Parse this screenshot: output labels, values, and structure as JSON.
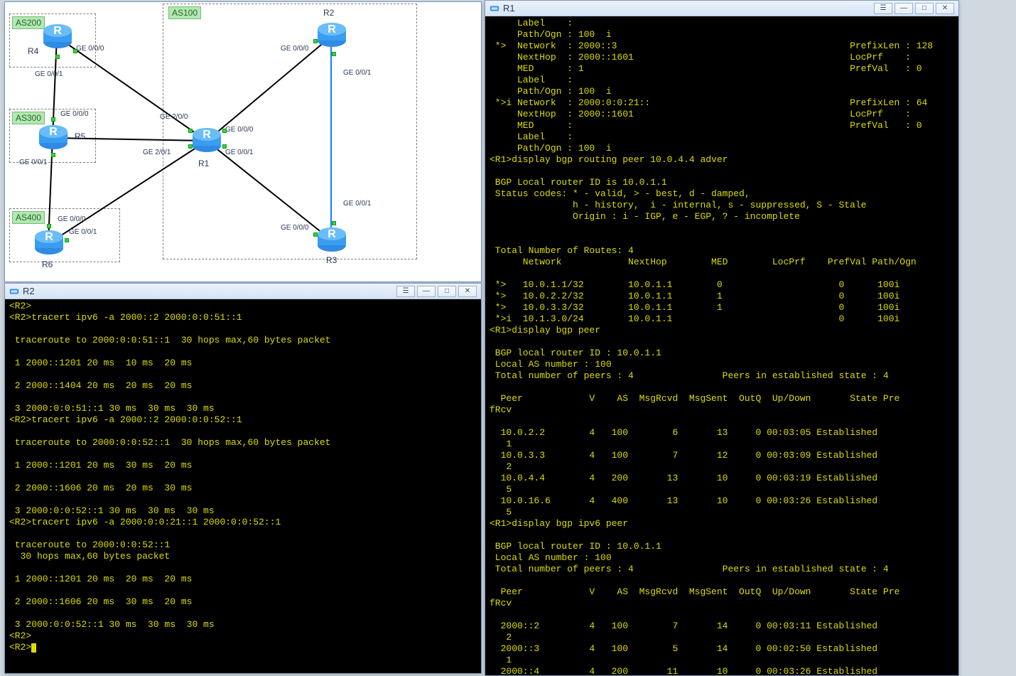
{
  "windows": {
    "r1": {
      "title": "R1"
    },
    "r2": {
      "title": "R2"
    },
    "topology": {
      "title": ""
    }
  },
  "winbtns": {
    "min": "—",
    "max": "□",
    "close": "✕"
  },
  "topology": {
    "as_labels": {
      "as200": "AS200",
      "as300": "AS300",
      "as400": "AS400",
      "as100": "AS100"
    },
    "routers": {
      "r1": "R1",
      "r2": "R2",
      "r3": "R3",
      "r4": "R4",
      "r5": "R5",
      "r6": "R6"
    },
    "interfaces": {
      "ge000": "GE 0/0/0",
      "ge001": "GE 0/0/1",
      "ge200": "GE 2/0/0",
      "ge201": "GE 2/0/1"
    }
  },
  "r2_output": "<R2>\n<R2>tracert ipv6 -a 2000::2 2000:0:0:51::1\n\n traceroute to 2000:0:0:51::1  30 hops max,60 bytes packet\n\n 1 2000::1201 20 ms  10 ms  20 ms\n\n 2 2000::1404 20 ms  20 ms  20 ms\n\n 3 2000:0:0:51::1 30 ms  30 ms  30 ms\n<R2>tracert ipv6 -a 2000::2 2000:0:0:52::1\n\n traceroute to 2000:0:0:52::1  30 hops max,60 bytes packet\n\n 1 2000::1201 20 ms  30 ms  20 ms\n\n 2 2000::1606 20 ms  20 ms  30 ms\n\n 3 2000:0:0:52::1 30 ms  30 ms  30 ms\n<R2>tracert ipv6 -a 2000:0:0:21::1 2000:0:0:52::1\n\n traceroute to 2000:0:0:52::1\n  30 hops max,60 bytes packet\n\n 1 2000::1201 20 ms  20 ms  20 ms\n\n 2 2000::1606 20 ms  30 ms  20 ms\n\n 3 2000:0:0:52::1 30 ms  30 ms  30 ms\n<R2>\n<R2>",
  "r1_output": "     Label    :\n     Path/Ogn : 100  i\n *>  Network  : 2000::3                                          PrefixLen : 128\n     NextHop  : 2000::1601                                       LocPrf    :\n     MED      : 1                                                PrefVal   : 0\n     Label    :\n     Path/Ogn : 100  i\n *>i Network  : 2000:0:0:21::                                    PrefixLen : 64\n     NextHop  : 2000::1601                                       LocPrf    :\n     MED      :                                                  PrefVal   : 0\n     Label    :\n     Path/Ogn : 100  i\n<R1>display bgp routing peer 10.0.4.4 adver\n\n BGP Local router ID is 10.0.1.1\n Status codes: * - valid, > - best, d - damped,\n               h - history,  i - internal, s - suppressed, S - Stale\n               Origin : i - IGP, e - EGP, ? - incomplete\n\n\n Total Number of Routes: 4\n      Network            NextHop        MED        LocPrf    PrefVal Path/Ogn\n\n *>   10.0.1.1/32        10.0.1.1        0                     0      100i\n *>   10.0.2.2/32        10.0.1.1        1                     0      100i\n *>   10.0.3.3/32        10.0.1.1        1                     0      100i\n *>i  10.1.3.0/24        10.0.1.1                              0      100i\n<R1>display bgp peer\n\n BGP local router ID : 10.0.1.1\n Local AS number : 100\n Total number of peers : 4\t\t  Peers in established state : 4\n\n  Peer            V    AS  MsgRcvd  MsgSent  OutQ  Up/Down       State Pre\nfRcv\n\n  10.0.2.2        4   100        6       13     0 00:03:05 Established\n   1\n  10.0.3.3        4   100        7       12     0 00:03:09 Established\n   2\n  10.0.4.4        4   200       13       10     0 00:03:19 Established\n   5\n  10.0.16.6       4   400       13       10     0 00:03:26 Established\n   5\n<R1>display bgp ipv6 peer\n\n BGP local router ID : 10.0.1.1\n Local AS number : 100\n Total number of peers : 4\t\t  Peers in established state : 4\n\n  Peer            V    AS  MsgRcvd  MsgSent  OutQ  Up/Down       State Pre\nfRcv\n\n  2000::2         4   100        7       14     0 00:03:11 Established\n   2\n  2000::3         4   100        5       14     0 00:02:50 Established\n   1\n  2000::4         4   200       11       10     0 00:03:26 Established"
}
